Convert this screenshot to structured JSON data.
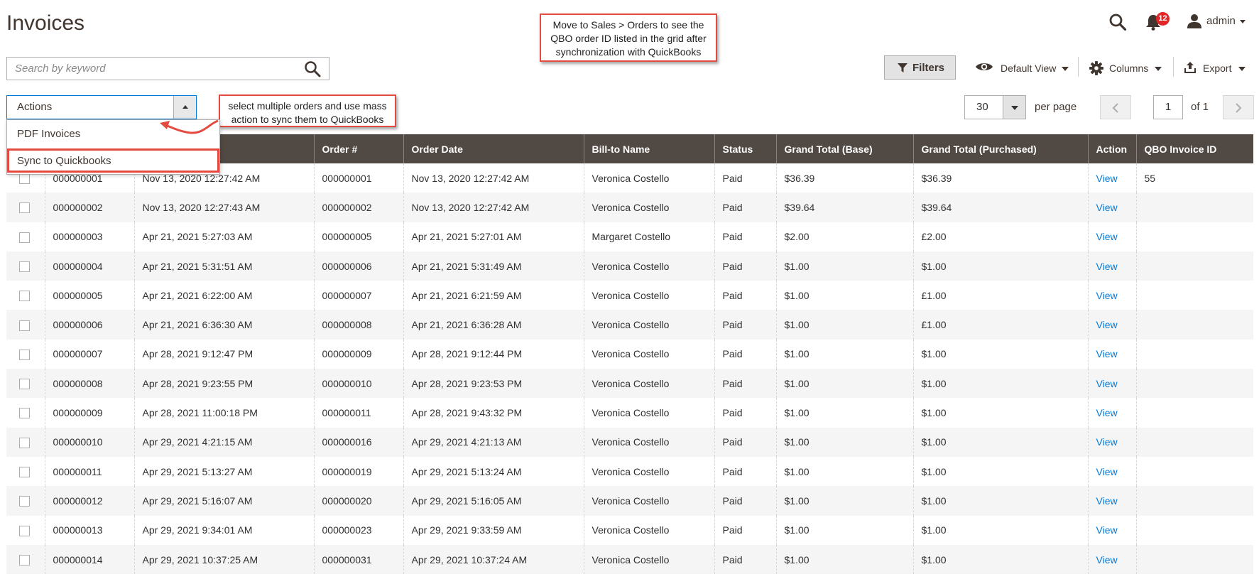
{
  "page": {
    "title": "Invoices"
  },
  "header": {
    "notifications_count": "12",
    "user": "admin"
  },
  "callouts": {
    "top": "Move to Sales > Orders to see the QBO order ID listed in the grid after synchronization with QuickBooks",
    "mid": "select multiple orders and use mass action to sync them to QuickBooks"
  },
  "search": {
    "placeholder": "Search by keyword"
  },
  "toolbar": {
    "filters_label": "Filters",
    "view_label": "Default View",
    "columns_label": "Columns",
    "export_label": "Export"
  },
  "actions": {
    "label": "Actions",
    "items": [
      "PDF Invoices",
      "Sync to Quickbooks"
    ]
  },
  "pagination": {
    "per_page_value": "30",
    "per_page_label": "per page",
    "current_page": "1",
    "of_label": "of 1"
  },
  "colors": {
    "header_bg": "#514943",
    "link": "#007bdb",
    "callout_border": "#e44b40",
    "badge": "#e22626"
  },
  "grid": {
    "columns": [
      "",
      "",
      "",
      "Order #",
      "Order Date",
      "Bill-to Name",
      "Status",
      "Grand Total (Base)",
      "Grand Total (Purchased)",
      "Action",
      "QBO Invoice ID"
    ],
    "rows": [
      [
        "000000001",
        "Nov 13, 2020 12:27:42 AM",
        "000000001",
        "Nov 13, 2020 12:27:42 AM",
        "Veronica Costello",
        "Paid",
        "$36.39",
        "$36.39",
        "View",
        "55"
      ],
      [
        "000000002",
        "Nov 13, 2020 12:27:43 AM",
        "000000002",
        "Nov 13, 2020 12:27:42 AM",
        "Veronica Costello",
        "Paid",
        "$39.64",
        "$39.64",
        "View",
        ""
      ],
      [
        "000000003",
        "Apr 21, 2021 5:27:03 AM",
        "000000005",
        "Apr 21, 2021 5:27:01 AM",
        "Margaret Costello",
        "Paid",
        "$2.00",
        "£2.00",
        "View",
        ""
      ],
      [
        "000000004",
        "Apr 21, 2021 5:31:51 AM",
        "000000006",
        "Apr 21, 2021 5:31:49 AM",
        "Veronica Costello",
        "Paid",
        "$1.00",
        "$1.00",
        "View",
        ""
      ],
      [
        "000000005",
        "Apr 21, 2021 6:22:00 AM",
        "000000007",
        "Apr 21, 2021 6:21:59 AM",
        "Veronica Costello",
        "Paid",
        "$1.00",
        "£1.00",
        "View",
        ""
      ],
      [
        "000000006",
        "Apr 21, 2021 6:36:30 AM",
        "000000008",
        "Apr 21, 2021 6:36:28 AM",
        "Veronica Costello",
        "Paid",
        "$1.00",
        "£1.00",
        "View",
        ""
      ],
      [
        "000000007",
        "Apr 28, 2021 9:12:47 PM",
        "000000009",
        "Apr 28, 2021 9:12:44 PM",
        "Veronica Costello",
        "Paid",
        "$1.00",
        "$1.00",
        "View",
        ""
      ],
      [
        "000000008",
        "Apr 28, 2021 9:23:55 PM",
        "000000010",
        "Apr 28, 2021 9:23:53 PM",
        "Veronica Costello",
        "Paid",
        "$1.00",
        "$1.00",
        "View",
        ""
      ],
      [
        "000000009",
        "Apr 28, 2021 11:00:18 PM",
        "000000011",
        "Apr 28, 2021 9:43:32 PM",
        "Veronica Costello",
        "Paid",
        "$1.00",
        "$1.00",
        "View",
        ""
      ],
      [
        "000000010",
        "Apr 29, 2021 4:21:15 AM",
        "000000016",
        "Apr 29, 2021 4:21:13 AM",
        "Veronica Costello",
        "Paid",
        "$1.00",
        "$1.00",
        "View",
        ""
      ],
      [
        "000000011",
        "Apr 29, 2021 5:13:27 AM",
        "000000019",
        "Apr 29, 2021 5:13:24 AM",
        "Veronica Costello",
        "Paid",
        "$1.00",
        "$1.00",
        "View",
        ""
      ],
      [
        "000000012",
        "Apr 29, 2021 5:16:07 AM",
        "000000020",
        "Apr 29, 2021 5:16:05 AM",
        "Veronica Costello",
        "Paid",
        "$1.00",
        "$1.00",
        "View",
        ""
      ],
      [
        "000000013",
        "Apr 29, 2021 9:34:01 AM",
        "000000023",
        "Apr 29, 2021 9:33:59 AM",
        "Veronica Costello",
        "Paid",
        "$1.00",
        "$1.00",
        "View",
        ""
      ],
      [
        "000000014",
        "Apr 29, 2021 10:37:25 AM",
        "000000031",
        "Apr 29, 2021 10:37:24 AM",
        "Veronica Costello",
        "Paid",
        "$1.00",
        "$1.00",
        "View",
        ""
      ]
    ]
  }
}
